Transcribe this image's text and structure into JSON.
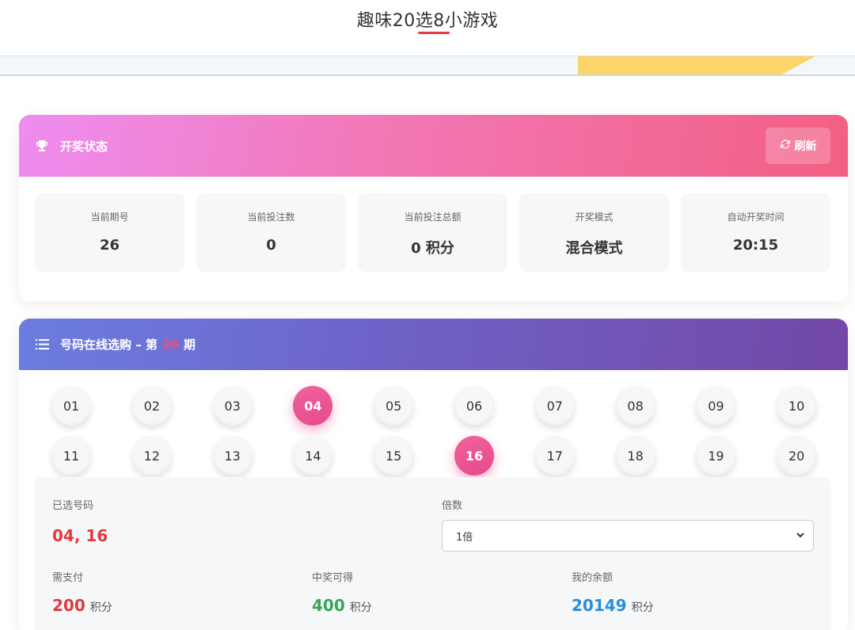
{
  "page": {
    "title": "趣味20选8小游戏"
  },
  "colors": {
    "accent_red": "#e0393e",
    "card1_gradient": [
      "#ee8df0",
      "#f25f83"
    ],
    "card2_gradient": [
      "#6b7de0",
      "#7348a6"
    ],
    "selected_ball": "#e54a8c",
    "win_green": "#3aa655",
    "balance_blue": "#2a8fd6"
  },
  "draw_status": {
    "title": "开奖状态",
    "icon": "trophy-icon",
    "refresh_label": "刷新",
    "refresh_icon": "refresh-icon",
    "stats": [
      {
        "label": "当前期号",
        "value": "26"
      },
      {
        "label": "当前投注数",
        "value": "0"
      },
      {
        "label": "当前投注总额",
        "value": "0 积分"
      },
      {
        "label": "开奖模式",
        "value": "混合模式"
      },
      {
        "label": "自动开奖时间",
        "value": "20:15"
      }
    ]
  },
  "picker": {
    "icon": "list-icon",
    "title_prefix": "号码在线选购 – 第",
    "period": "26",
    "title_suffix": "期",
    "numbers": [
      "01",
      "02",
      "03",
      "04",
      "05",
      "06",
      "07",
      "08",
      "09",
      "10",
      "11",
      "12",
      "13",
      "14",
      "15",
      "16",
      "17",
      "18",
      "19",
      "20"
    ],
    "selected": [
      "04",
      "16"
    ]
  },
  "summary": {
    "selected_label": "已选号码",
    "selected_value": "04, 16",
    "multiplier_label": "倍数",
    "multiplier_value": "1倍",
    "pay_label": "需支付",
    "pay_value": "200",
    "win_label": "中奖可得",
    "win_value": "400",
    "balance_label": "我的余额",
    "balance_value": "20149",
    "unit": "积分"
  }
}
